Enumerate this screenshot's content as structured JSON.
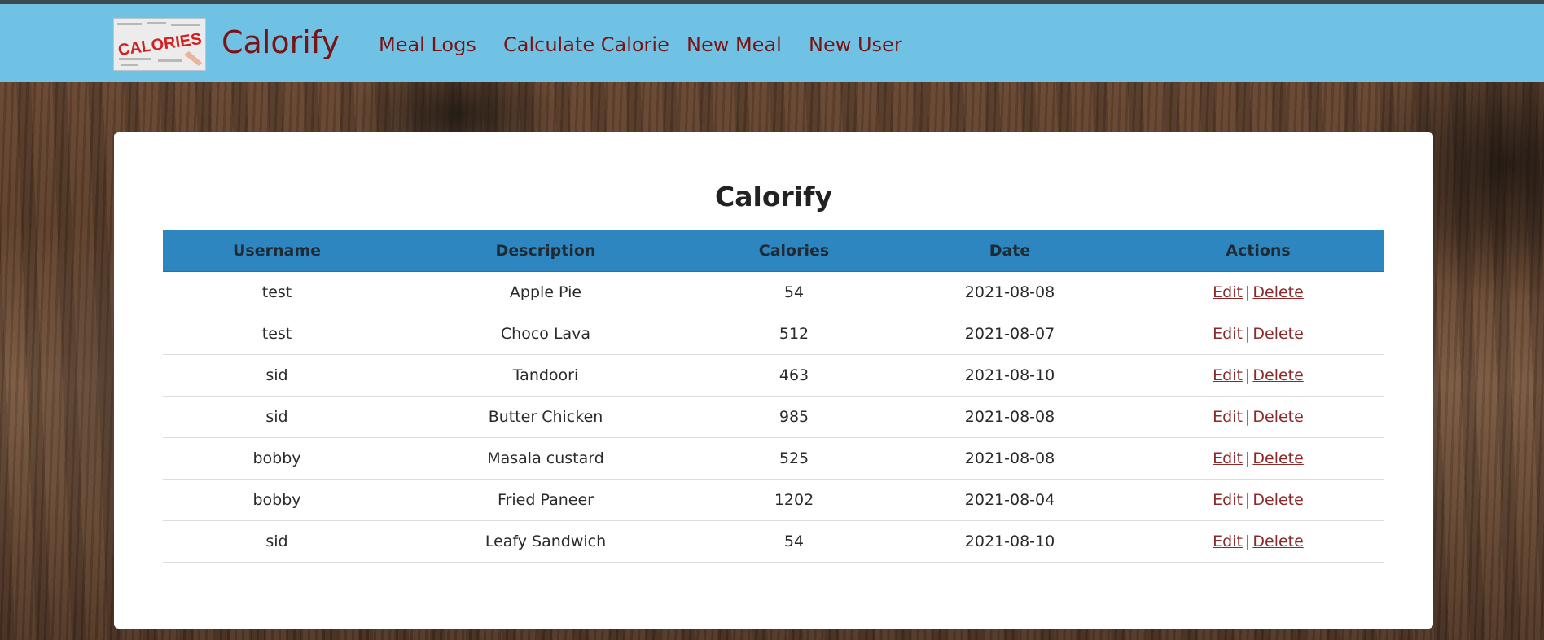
{
  "navbar": {
    "logo_text": "CALORIES",
    "brand": "Calorify",
    "items": [
      {
        "label": "Meal Logs"
      },
      {
        "label": "Calculate Calorie"
      },
      {
        "label": "New Meal"
      },
      {
        "label": "New User"
      }
    ]
  },
  "main": {
    "title": "Calorify",
    "columns": [
      "Username",
      "Description",
      "Calories",
      "Date",
      "Actions"
    ],
    "edit_label": "Edit",
    "delete_label": "Delete",
    "separator": "|",
    "rows": [
      {
        "username": "test",
        "description": "Apple Pie",
        "calories": "54",
        "date": "2021-08-08"
      },
      {
        "username": "test",
        "description": "Choco Lava",
        "calories": "512",
        "date": "2021-08-07"
      },
      {
        "username": "sid",
        "description": "Tandoori",
        "calories": "463",
        "date": "2021-08-10"
      },
      {
        "username": "sid",
        "description": "Butter Chicken",
        "calories": "985",
        "date": "2021-08-08"
      },
      {
        "username": "bobby",
        "description": "Masala custard",
        "calories": "525",
        "date": "2021-08-08"
      },
      {
        "username": "bobby",
        "description": "Fried Paneer",
        "calories": "1202",
        "date": "2021-08-04"
      },
      {
        "username": "sid",
        "description": "Leafy Sandwich",
        "calories": "54",
        "date": "2021-08-10"
      }
    ]
  },
  "colors": {
    "navbar": "#6fc2e3",
    "nav_text": "#7a1414",
    "table_header": "#2e86c1",
    "link": "#8b2a2a"
  }
}
